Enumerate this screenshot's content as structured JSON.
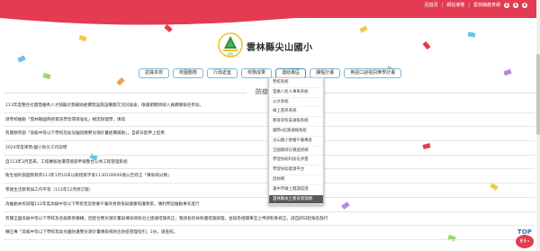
{
  "header": {
    "links": [
      "回首頁",
      "網站導覽",
      "雲林縣教育網"
    ],
    "font_buttons": [
      "A",
      "A",
      "A"
    ],
    "school_name": "雲林縣尖山國小",
    "logo_text": "尖山"
  },
  "nav": {
    "items": [
      "認識本校",
      "校園動態",
      "行政處室",
      "校務成果",
      "連結專區",
      "課程計畫",
      "英語口說視訊樂學計畫"
    ]
  },
  "section": {
    "title": "防疫"
  },
  "news": [
    "113年度整合社團暨優秀人才鼓勵計劃補助經費暨設施設備圖交流討論會，敬邀相關領域人員踴躍報名參加。",
    "請學校推動「雲林縣國際感資訊學習環境強化」規定辦理學，填寫",
    "有關教育部「高級中等以下學校及幼兒園因應嬰兒潮計畫經費補助」，自即日起申上提用",
    "2024年度東勢/國小防災工作說明",
    "自113年3月首來，工程審核後遭環境部申報整合公共工程管理系統",
    "衛生福利部國民教育113年1月10日以衛授家字第1130100040號公告修正「傳染病分類」",
    "零歲生活教育與工作平等（112年12月修訂版）",
    "為推動本校辦理112年度高級中等以下學校普及營養午餐改善政策與健康照護政策，傳利學區推動事先進行",
    "有關全國高級中等以下學校及各級教育機構，因配合嬰兒潮計畫與傳染病防治之建議措施修正，敬請各校依防護措施辦理，並知悉相關事宜之申請對象修正，請自即日起報名施行",
    "轉正專「高級中等以下學校及幼兒園防護嬰兒潮計畫傳染病防治防疫管理指引」1份，請查照。"
  ],
  "dropdown": {
    "items": [
      "學校系統",
      "雲嘉八校人事車系統",
      "公文系統",
      "線上進修系統",
      "教育部校安通報系統",
      "國際e起來通報系統",
      "尖山國小營養午餐專區",
      "全國教師在職進修網",
      "學習扶助科技化評量",
      "學習扶助資源平台",
      "因材網",
      "書中市線上閱讀認證",
      "雲林縣本土教育資源網"
    ],
    "active_index": 12
  },
  "top_button": {
    "label": "TOP",
    "sub": "更多 ▸"
  },
  "colors": {
    "banner": "#e23b52",
    "nav_border": "#7db7d6",
    "dropdown_active": "#5a5a5a"
  }
}
